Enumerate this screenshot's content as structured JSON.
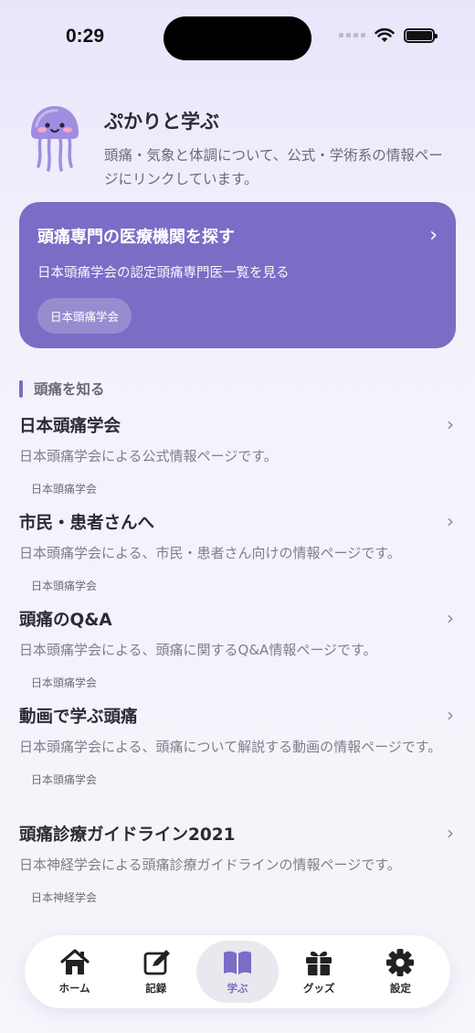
{
  "status_bar": {
    "time": "0:29"
  },
  "header": {
    "title": "ぷかりと学ぶ",
    "subtitle": "頭痛・気象と体調について、公式・学術系の情報ページにリンクしています。"
  },
  "hero": {
    "title": "頭痛専門の医療機関を探す",
    "subtitle": "日本頭痛学会の認定頭痛専門医一覧を見る",
    "chip": "日本頭痛学会"
  },
  "section": {
    "label": "頭痛を知る"
  },
  "items": [
    {
      "title": "日本頭痛学会",
      "desc": "日本頭痛学会による公式情報ページです。",
      "source": "日本頭痛学会"
    },
    {
      "title": "市民・患者さんへ",
      "desc": "日本頭痛学会による、市民・患者さん向けの情報ページです。",
      "source": "日本頭痛学会"
    },
    {
      "title": "頭痛のQ&A",
      "desc": "日本頭痛学会による、頭痛に関するQ&A情報ページです。",
      "source": "日本頭痛学会"
    },
    {
      "title": "動画で学ぶ頭痛",
      "desc": "日本頭痛学会による、頭痛について解説する動画の情報ページです。",
      "source": "日本頭痛学会"
    },
    {
      "title": "頭痛診療ガイドライン2021",
      "desc": "日本神経学会による頭痛診療ガイドラインの情報ページです。",
      "source": "日本神経学会"
    }
  ],
  "tabbar": {
    "tabs": [
      {
        "label": "ホーム",
        "icon": "house-icon"
      },
      {
        "label": "記録",
        "icon": "edit-icon"
      },
      {
        "label": "学ぶ",
        "icon": "book-icon",
        "active": true
      },
      {
        "label": "グッズ",
        "icon": "gift-icon"
      },
      {
        "label": "設定",
        "icon": "gear-icon"
      }
    ]
  },
  "colors": {
    "accent": "#7b6cc5",
    "background": "#f3f1fb"
  }
}
